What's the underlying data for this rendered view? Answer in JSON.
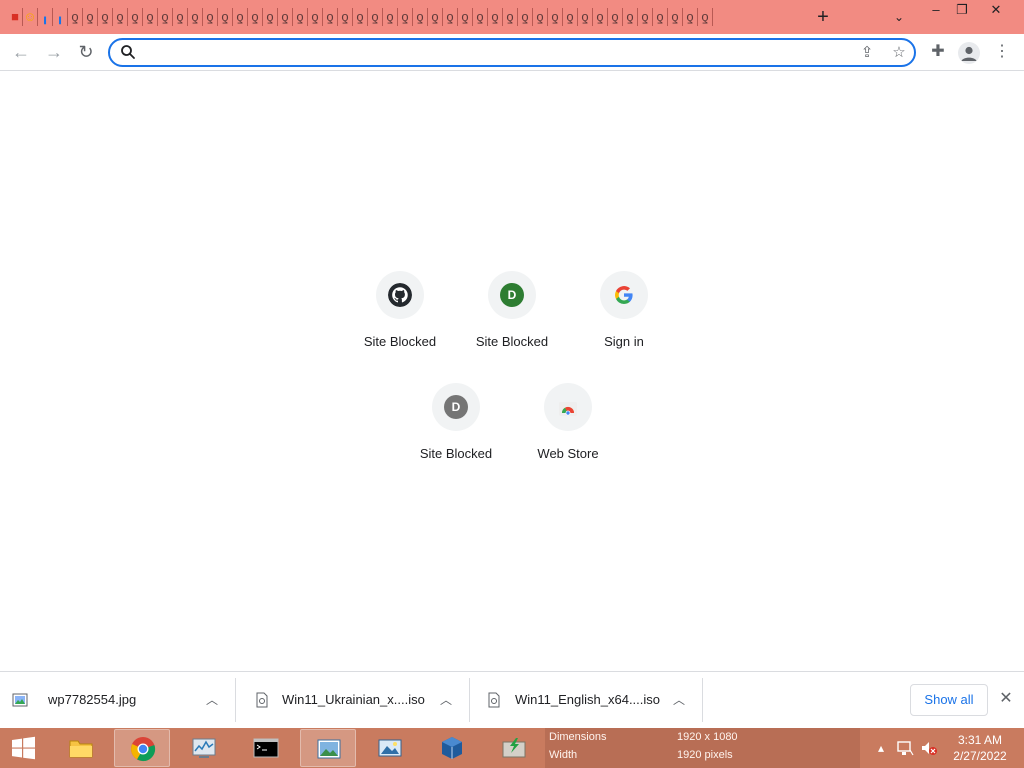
{
  "tab_strip": {
    "tab_icon_count": 47,
    "newtab_glyph": "+",
    "tablist_glyph": "⌄",
    "minimize_glyph": "–",
    "restore_glyph": "❐",
    "close_glyph": "✕"
  },
  "toolbar": {
    "back_glyph": "←",
    "forward_glyph": "→",
    "reload_glyph": "↻",
    "address_value": "",
    "share_glyph": "⇪",
    "bookmark_glyph": "☆",
    "extensions_glyph": "✚",
    "menu_glyph": "⋮"
  },
  "shortcuts": [
    {
      "label": "Site Blocked",
      "icon": "github-icon"
    },
    {
      "label": "Site Blocked",
      "icon": "letter-d-green",
      "letter": "D",
      "color": "#2e7d32"
    },
    {
      "label": "Sign in",
      "icon": "google-g-icon"
    },
    {
      "label": "Site Blocked",
      "icon": "letter-d-gray",
      "letter": "D",
      "color": "#757575"
    },
    {
      "label": "Web Store",
      "icon": "chrome-web-store-icon"
    }
  ],
  "downloads": {
    "items": [
      {
        "name": "wp7782554.jpg",
        "icon": "image-file-icon"
      },
      {
        "name": "Win11_Ukrainian_x....iso",
        "icon": "disc-file-icon"
      },
      {
        "name": "Win11_English_x64....iso",
        "icon": "disc-file-icon"
      }
    ],
    "show_all_label": "Show all",
    "close_glyph": "✕",
    "chevron_glyph": "︿"
  },
  "taskbar": {
    "apps": [
      "file-explorer",
      "chrome",
      "performance-monitor",
      "command-prompt",
      "image-viewer",
      "image-viewer-2",
      "virtualbox",
      "installer"
    ],
    "info": {
      "dimensions_label": "Dimensions",
      "dimensions_value": "1920 x 1080",
      "width_label": "Width",
      "width_value": "1920 pixels"
    },
    "clock": {
      "time": "3:31 AM",
      "date": "2/27/2022"
    },
    "tray_up_glyph": "▴"
  },
  "colors": {
    "tab_strip_bg": "#f28b82",
    "accent": "#1a73e8",
    "taskbar_bg": "#c97b5f"
  }
}
